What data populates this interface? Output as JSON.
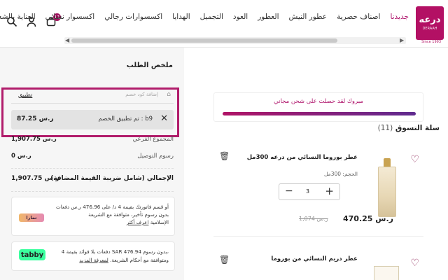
{
  "header": {
    "logo": {
      "line1": "درعه",
      "line2": "DERAAH",
      "since": "Since 1993"
    },
    "nav": [
      "جديدنا",
      "اصناف حصرية",
      "عطور النيش",
      "العطور",
      "العود",
      "التجميل",
      "الهدايا",
      "اكسسوارات رجالي",
      "اكسسوار نسائي",
      "العناية بالشعر"
    ],
    "cart_count": "11",
    "icons": [
      "search-icon",
      "user-icon",
      "cart-icon"
    ]
  },
  "summary": {
    "title": "ملخص الطلب",
    "coupon": {
      "apply_label": "تطبيق",
      "placeholder": "إضافة كود خصم"
    },
    "applied_discount": {
      "text": "تم تطبيق الخصم : b9",
      "amount": "87.25 ر.س"
    },
    "rows": [
      {
        "label": "المجموع الفرعي",
        "value": "1,907.75 ر.س"
      },
      {
        "label": "رسوم التوصيل",
        "value": "0 ر.س"
      }
    ],
    "total": {
      "label": "الإجمالي (شامل ضريبة القيمة المضافة)",
      "value": "1,907.75 ر.س"
    },
    "tamara": {
      "logo": "تمارا",
      "line1": "أو قسم فاتورتك بقيمة 4 د/ على 476.96 ر.س دفعات",
      "line2": "بدون رسوم تأخير، متوافقة مع الشريعة",
      "line3": "الإسلامية",
      "link": "اعرف أكثر"
    },
    "tabby": {
      "logo": "tabby",
      "line1": "4 دفعات بلا فوائد بقيمة SAR 476.94 بدون رسوم،",
      "line2": "ومتوافقة مع أحكام الشريعة.",
      "link": "لمعرفة المزيد"
    }
  },
  "cart": {
    "shipping_message": "مبروك لقد حصلت على شحن مجاني",
    "shipping_progress": 1.0,
    "title": "سلة التسوق",
    "count": "(11)",
    "items": [
      {
        "name": "عطر بوروما النسائي من درعه 300مل",
        "size": "الحجم: 300مل",
        "qty": "3",
        "old_price": "1,074 ر.س",
        "price": "470.25 ر.س"
      },
      {
        "name": "عطر دريم النسائي من بوروما",
        "size": "",
        "qty": "",
        "old_price": "",
        "price": ""
      }
    ]
  },
  "colors": {
    "brand": "#b31064",
    "highlight": "#b11d6b"
  }
}
